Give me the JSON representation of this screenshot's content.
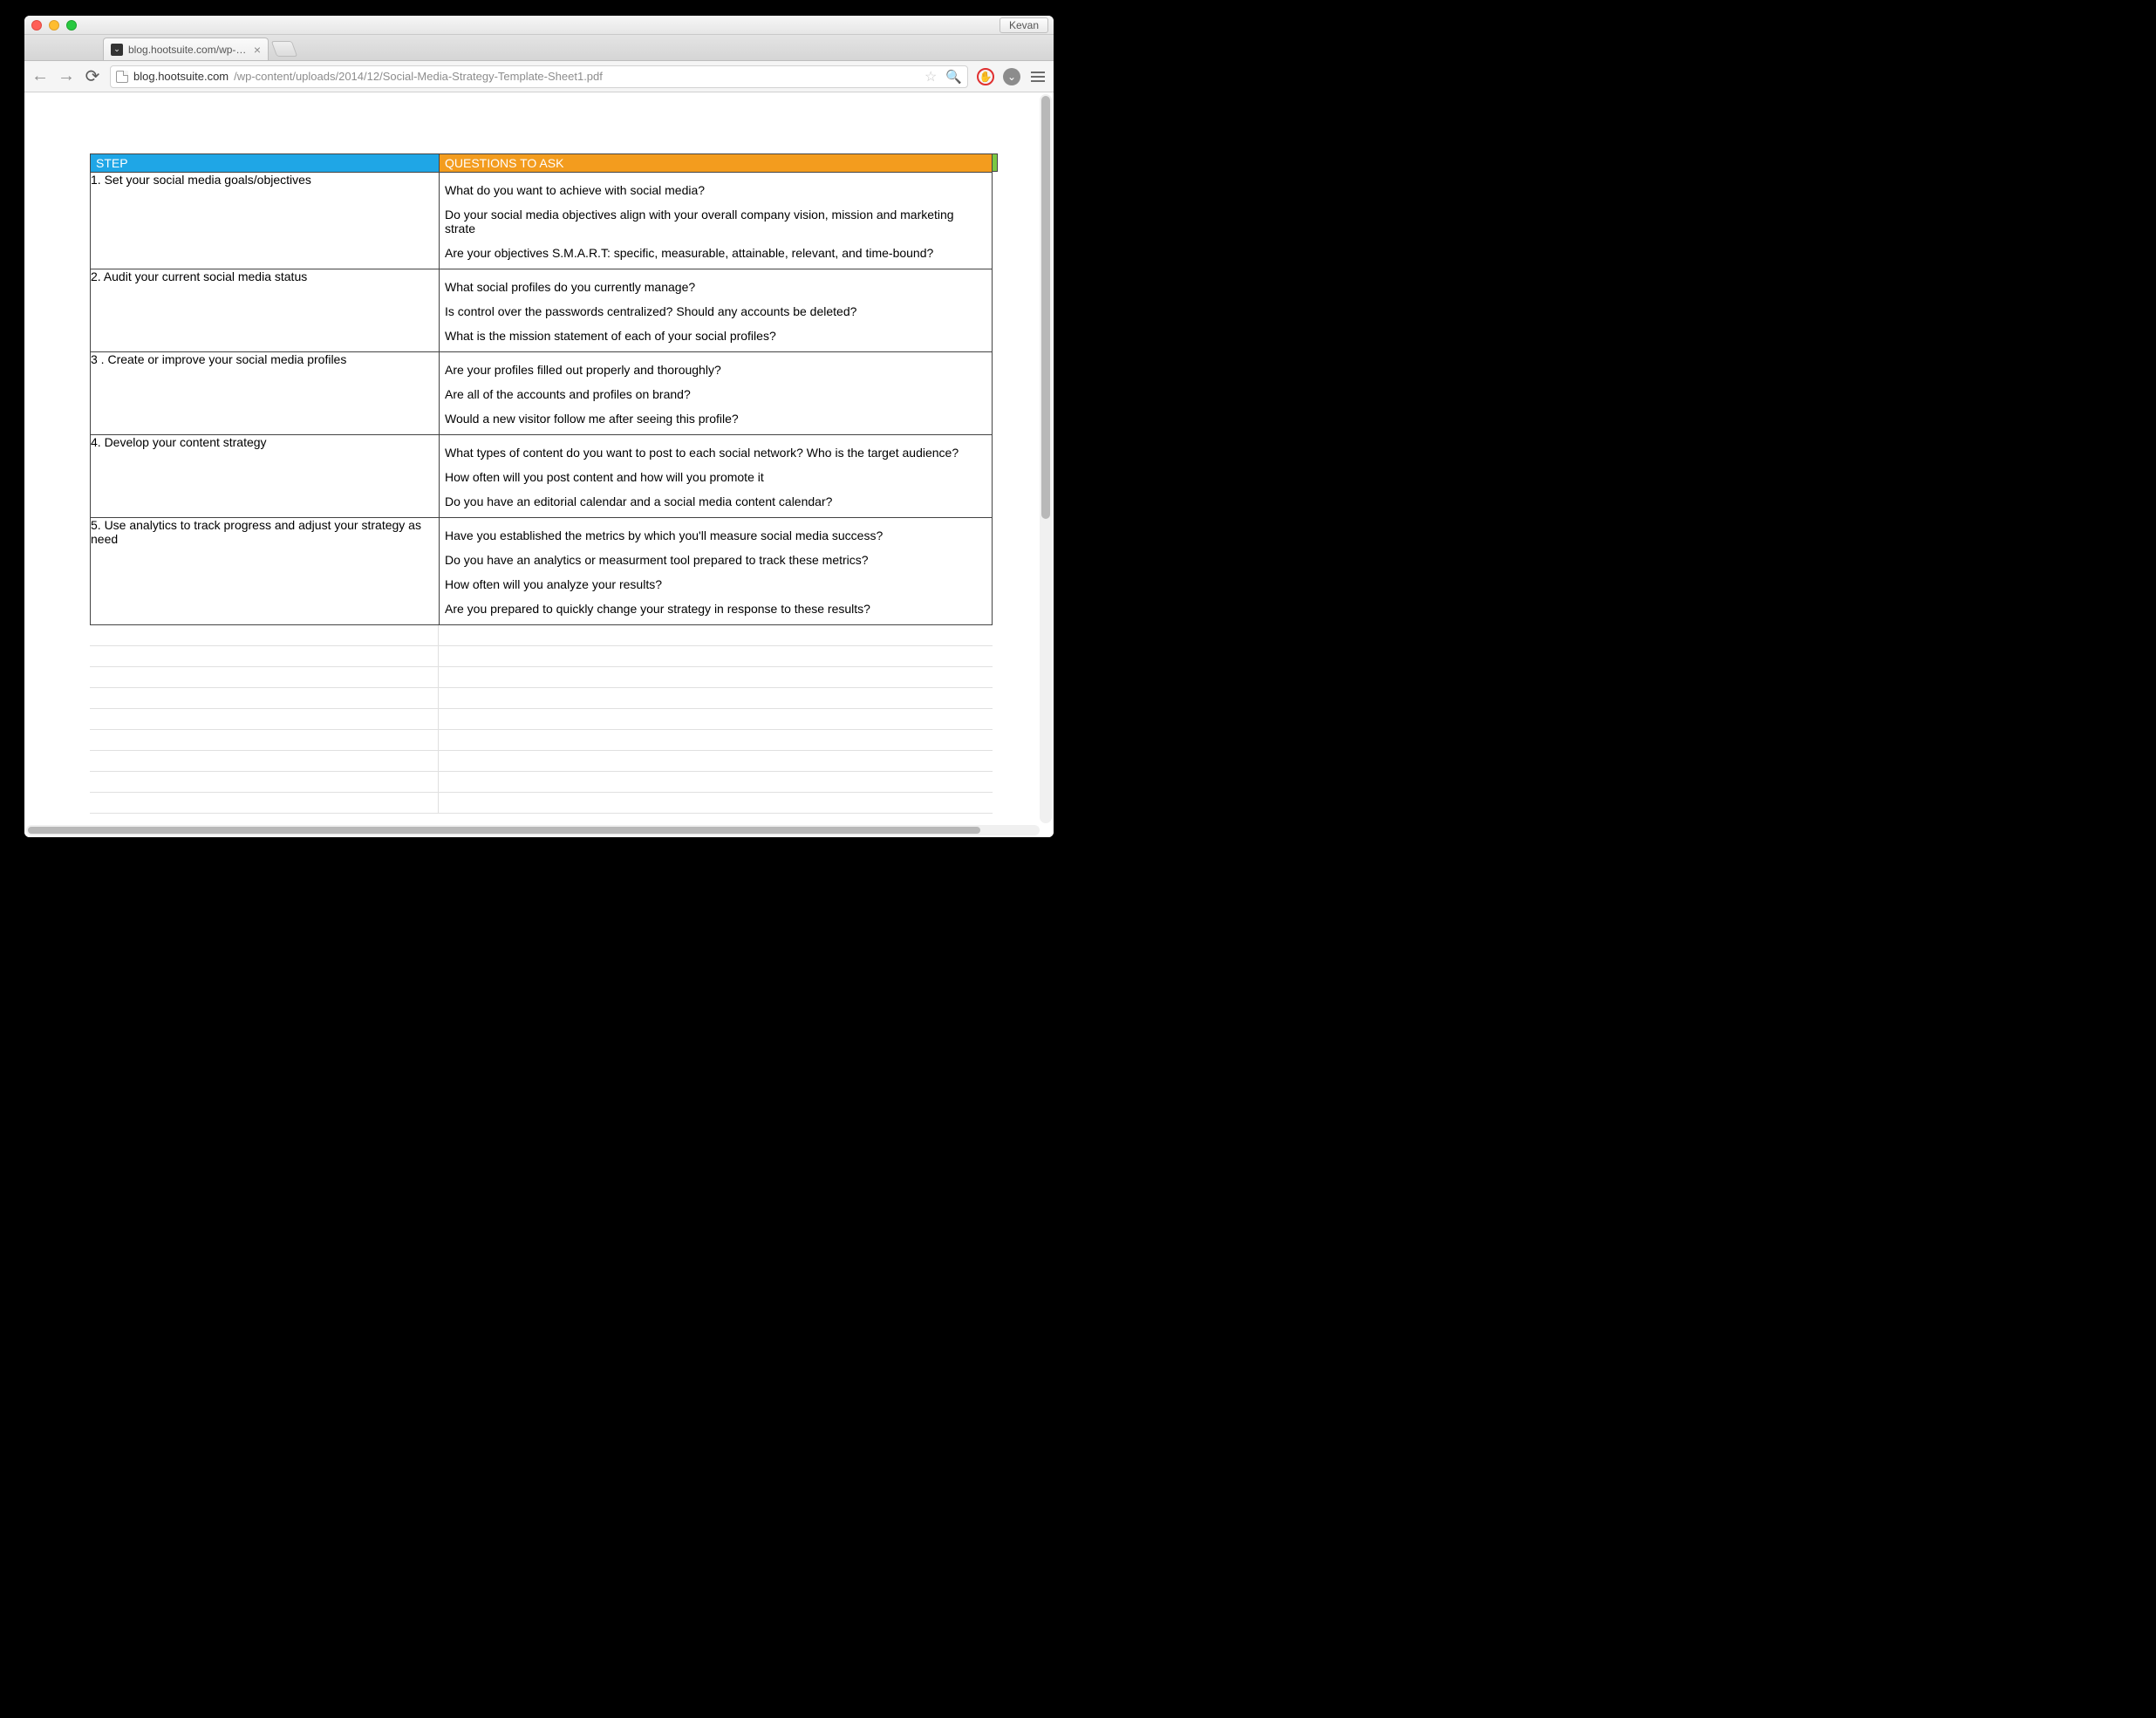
{
  "user_button": "Kevan",
  "tab": {
    "title": "blog.hootsuite.com/wp-con"
  },
  "url": {
    "host": "blog.hootsuite.com",
    "path": "/wp-content/uploads/2014/12/Social-Media-Strategy-Template-Sheet1.pdf"
  },
  "headers": {
    "step": "STEP",
    "questions": "QUESTIONS TO ASK"
  },
  "rows": [
    {
      "step": "1. Set your social media goals/objectives",
      "questions": [
        "What do you want to achieve with social media?",
        "Do your social media objectives align with your overall company vision, mission and marketing strate",
        "Are your objectives S.M.A.R.T: specific, measurable, attainable, relevant, and time-bound?"
      ]
    },
    {
      "step": "2. Audit your current social media status",
      "questions": [
        "What social profiles do you currently manage?",
        "Is control over the passwords centralized? Should any accounts be deleted?",
        "What is the mission statement of each of your social profiles?"
      ]
    },
    {
      "step": "3 . Create or improve your social media profiles",
      "questions": [
        "Are your profiles filled out properly and thoroughly?",
        "Are all of the accounts and profiles on brand?",
        "Would a new visitor follow me after seeing this profile?"
      ]
    },
    {
      "step": "4. Develop your content strategy",
      "questions": [
        "What types of content do you want to post to each social network? Who is the target audience?",
        "How often will you post content and how will you promote it",
        "Do you have an editorial calendar and a social media content calendar?"
      ]
    },
    {
      "step": "5. Use analytics to track progress and adjust your strategy as need",
      "questions": [
        "Have you established the metrics by which you'll measure social media success?",
        "Do you have an analytics or measurment tool prepared to track these metrics?",
        "How often will you analyze your results?",
        "Are you prepared to quickly change your strategy in response to these results?"
      ]
    }
  ],
  "empty_rows": 9
}
